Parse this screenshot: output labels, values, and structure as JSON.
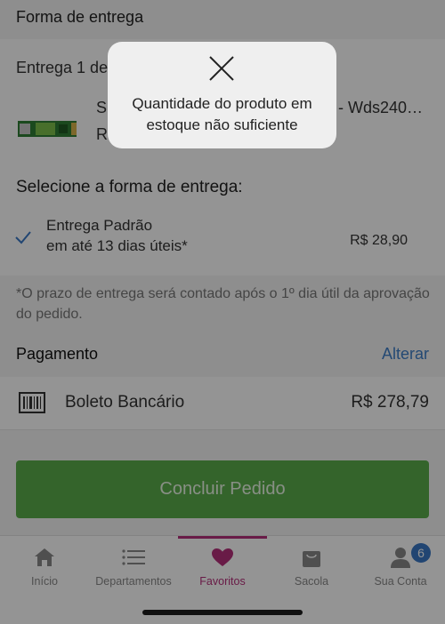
{
  "delivery": {
    "section_title": "Forma de entrega",
    "group_label": "Entrega 1 de",
    "product": {
      "name_start": "S",
      "name_end": "- Wds240…",
      "price_start": "R"
    },
    "select_title": "Selecione a forma de entrega:",
    "option": {
      "name": "Entrega Padrão",
      "time": "em até 13 dias úteis*",
      "price": "R$ 28,90"
    },
    "note": "*O prazo de entrega será contado após o 1º dia útil da aprovação do pedido."
  },
  "payment": {
    "title": "Pagamento",
    "change_label": "Alterar",
    "method": "Boleto Bancário",
    "total": "R$ 278,79"
  },
  "submit": {
    "label": "Concluir Pedido"
  },
  "tabs": [
    {
      "label": "Início",
      "icon": "home-icon"
    },
    {
      "label": "Departamentos",
      "icon": "list-icon"
    },
    {
      "label": "Favoritos",
      "icon": "heart-icon"
    },
    {
      "label": "Sacola",
      "icon": "bag-icon"
    },
    {
      "label": "Sua Conta",
      "icon": "user-icon"
    }
  ],
  "account_badge": "6",
  "toast": {
    "message": "Quantidade do produto em estoque não suficiente"
  },
  "colors": {
    "accent": "#b5307a",
    "link": "#3f7fc8",
    "button": "#5aad4a",
    "badge": "#3a78c4"
  }
}
